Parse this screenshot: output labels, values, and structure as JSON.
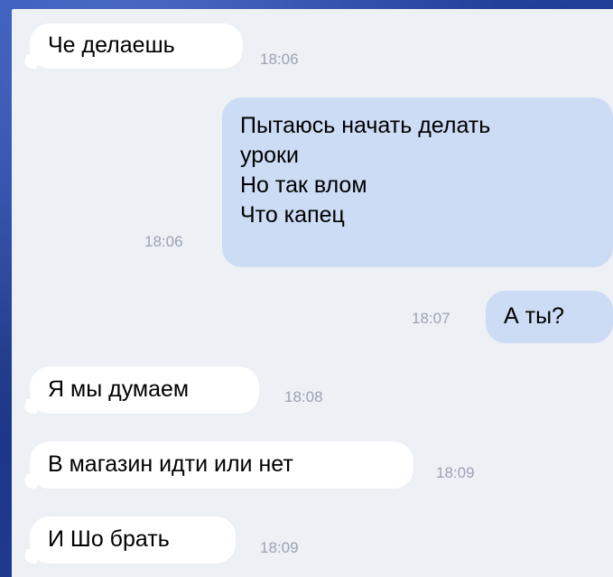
{
  "messages": [
    {
      "dir": "in",
      "text": "Че делаешь",
      "time": "18:06"
    },
    {
      "dir": "out",
      "lines": [
        "Пытаюсь начать делать",
        "уроки",
        "Но так влом",
        "Что капец"
      ],
      "time": "18:06"
    },
    {
      "dir": "out",
      "text": "А ты?",
      "time": "18:07"
    },
    {
      "dir": "in",
      "text": "Я мы думаем",
      "time": "18:08"
    },
    {
      "dir": "in",
      "text": "В магазин идти или нет",
      "time": "18:09"
    },
    {
      "dir": "in",
      "text": "И Шо брать",
      "time": "18:09"
    }
  ],
  "colors": {
    "incoming_bubble": "#ffffff",
    "outgoing_bubble": "#cbdcf4",
    "chat_background": "#edf0f5",
    "timestamp": "#9aa3b3"
  }
}
